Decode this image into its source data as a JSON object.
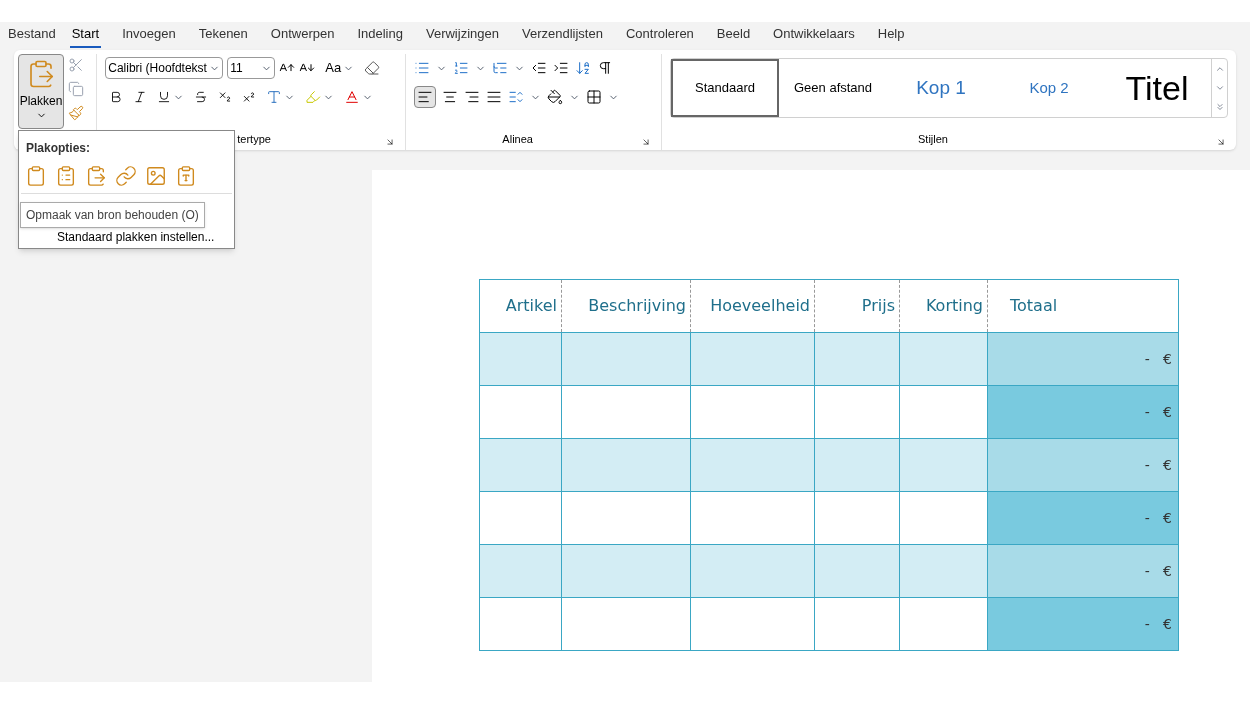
{
  "menu_tabs": [
    {
      "label": "Bestand",
      "selected": false
    },
    {
      "label": "Start",
      "selected": true
    },
    {
      "label": "Invoegen",
      "selected": false
    },
    {
      "label": "Tekenen",
      "selected": false
    },
    {
      "label": "Ontwerpen",
      "selected": false
    },
    {
      "label": "Indeling",
      "selected": false
    },
    {
      "label": "Verwijzingen",
      "selected": false
    },
    {
      "label": "Verzendlijsten",
      "selected": false
    },
    {
      "label": "Controleren",
      "selected": false
    },
    {
      "label": "Beeld",
      "selected": false
    },
    {
      "label": "Ontwikkelaars",
      "selected": false
    },
    {
      "label": "Help",
      "selected": false
    }
  ],
  "clipboard": {
    "paste_label": "Plakken",
    "paste_open": true
  },
  "font": {
    "family": "Calibri (Hoofdtekst",
    "size": "11",
    "change_case": "Aa",
    "group_label": "tertype"
  },
  "paragraph": {
    "group_label": "Alinea",
    "align_left_selected": true
  },
  "styles": {
    "group_label": "Stijlen",
    "items": [
      {
        "label": "Standaard",
        "kind": "normal",
        "selected": true
      },
      {
        "label": "Geen afstand",
        "kind": "normal",
        "selected": false
      },
      {
        "label": "Kop 1",
        "kind": "heading1",
        "selected": false
      },
      {
        "label": "Kop 2",
        "kind": "heading2",
        "selected": false
      },
      {
        "label": "Titel",
        "kind": "title",
        "selected": false
      }
    ]
  },
  "paste_menu": {
    "title": "Plakopties:",
    "items": [
      "Standaard plakken instellen..."
    ]
  },
  "tooltip": "Opmaak van bron behouden (O)",
  "table": {
    "columns": [
      "Artikel",
      "Beschrijving",
      "Hoeveelheid",
      "Prijs",
      "Korting",
      "Totaal"
    ],
    "rows": [
      {
        "shaded": true,
        "total": "-   €"
      },
      {
        "shaded": false,
        "total": "-   €"
      },
      {
        "shaded": true,
        "total": "-   €"
      },
      {
        "shaded": false,
        "total": "-   €"
      },
      {
        "shaded": true,
        "total": "-   €"
      },
      {
        "shaded": false,
        "total": "-   €"
      }
    ]
  }
}
